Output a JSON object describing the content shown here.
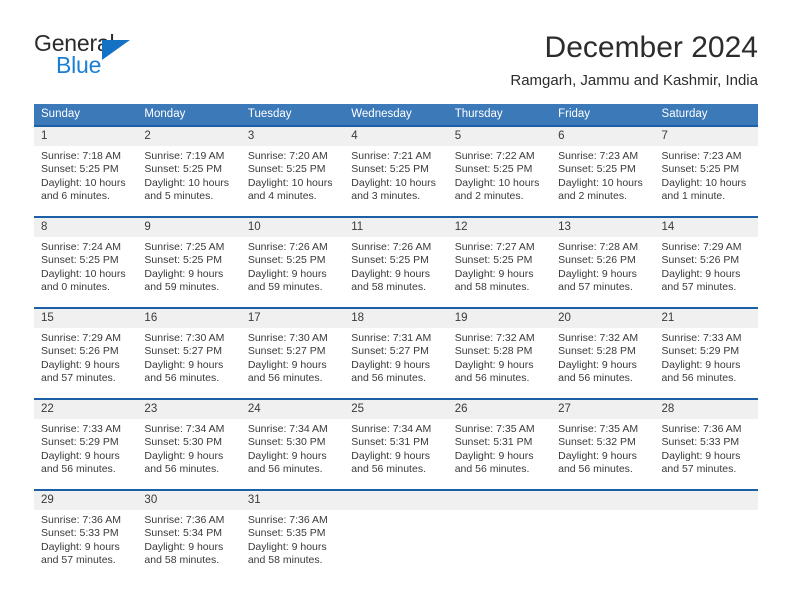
{
  "brand": {
    "name_top": "General",
    "name_bottom": "Blue",
    "triangle_color": "#1472c4",
    "blue_color": "#1a7fd4"
  },
  "header": {
    "title": "December 2024",
    "subtitle": "Ramgarh, Jammu and Kashmir, India"
  },
  "theme": {
    "header_bg": "#3b79b8",
    "header_text": "#ffffff",
    "week_border": "#1d5fa6",
    "daynum_bg": "#f0f0f0",
    "body_text": "#3a3a3a"
  },
  "weekdays": [
    "Sunday",
    "Monday",
    "Tuesday",
    "Wednesday",
    "Thursday",
    "Friday",
    "Saturday"
  ],
  "labels": {
    "sunrise_prefix": "Sunrise: ",
    "sunset_prefix": "Sunset: ",
    "daylight_prefix": "Daylight: "
  },
  "weeks": [
    [
      {
        "day": "1",
        "sunrise": "Sunrise: 7:18 AM",
        "sunset": "Sunset: 5:25 PM",
        "daylight": "Daylight: 10 hours and 6 minutes."
      },
      {
        "day": "2",
        "sunrise": "Sunrise: 7:19 AM",
        "sunset": "Sunset: 5:25 PM",
        "daylight": "Daylight: 10 hours and 5 minutes."
      },
      {
        "day": "3",
        "sunrise": "Sunrise: 7:20 AM",
        "sunset": "Sunset: 5:25 PM",
        "daylight": "Daylight: 10 hours and 4 minutes."
      },
      {
        "day": "4",
        "sunrise": "Sunrise: 7:21 AM",
        "sunset": "Sunset: 5:25 PM",
        "daylight": "Daylight: 10 hours and 3 minutes."
      },
      {
        "day": "5",
        "sunrise": "Sunrise: 7:22 AM",
        "sunset": "Sunset: 5:25 PM",
        "daylight": "Daylight: 10 hours and 2 minutes."
      },
      {
        "day": "6",
        "sunrise": "Sunrise: 7:23 AM",
        "sunset": "Sunset: 5:25 PM",
        "daylight": "Daylight: 10 hours and 2 minutes."
      },
      {
        "day": "7",
        "sunrise": "Sunrise: 7:23 AM",
        "sunset": "Sunset: 5:25 PM",
        "daylight": "Daylight: 10 hours and 1 minute."
      }
    ],
    [
      {
        "day": "8",
        "sunrise": "Sunrise: 7:24 AM",
        "sunset": "Sunset: 5:25 PM",
        "daylight": "Daylight: 10 hours and 0 minutes."
      },
      {
        "day": "9",
        "sunrise": "Sunrise: 7:25 AM",
        "sunset": "Sunset: 5:25 PM",
        "daylight": "Daylight: 9 hours and 59 minutes."
      },
      {
        "day": "10",
        "sunrise": "Sunrise: 7:26 AM",
        "sunset": "Sunset: 5:25 PM",
        "daylight": "Daylight: 9 hours and 59 minutes."
      },
      {
        "day": "11",
        "sunrise": "Sunrise: 7:26 AM",
        "sunset": "Sunset: 5:25 PM",
        "daylight": "Daylight: 9 hours and 58 minutes."
      },
      {
        "day": "12",
        "sunrise": "Sunrise: 7:27 AM",
        "sunset": "Sunset: 5:25 PM",
        "daylight": "Daylight: 9 hours and 58 minutes."
      },
      {
        "day": "13",
        "sunrise": "Sunrise: 7:28 AM",
        "sunset": "Sunset: 5:26 PM",
        "daylight": "Daylight: 9 hours and 57 minutes."
      },
      {
        "day": "14",
        "sunrise": "Sunrise: 7:29 AM",
        "sunset": "Sunset: 5:26 PM",
        "daylight": "Daylight: 9 hours and 57 minutes."
      }
    ],
    [
      {
        "day": "15",
        "sunrise": "Sunrise: 7:29 AM",
        "sunset": "Sunset: 5:26 PM",
        "daylight": "Daylight: 9 hours and 57 minutes."
      },
      {
        "day": "16",
        "sunrise": "Sunrise: 7:30 AM",
        "sunset": "Sunset: 5:27 PM",
        "daylight": "Daylight: 9 hours and 56 minutes."
      },
      {
        "day": "17",
        "sunrise": "Sunrise: 7:30 AM",
        "sunset": "Sunset: 5:27 PM",
        "daylight": "Daylight: 9 hours and 56 minutes."
      },
      {
        "day": "18",
        "sunrise": "Sunrise: 7:31 AM",
        "sunset": "Sunset: 5:27 PM",
        "daylight": "Daylight: 9 hours and 56 minutes."
      },
      {
        "day": "19",
        "sunrise": "Sunrise: 7:32 AM",
        "sunset": "Sunset: 5:28 PM",
        "daylight": "Daylight: 9 hours and 56 minutes."
      },
      {
        "day": "20",
        "sunrise": "Sunrise: 7:32 AM",
        "sunset": "Sunset: 5:28 PM",
        "daylight": "Daylight: 9 hours and 56 minutes."
      },
      {
        "day": "21",
        "sunrise": "Sunrise: 7:33 AM",
        "sunset": "Sunset: 5:29 PM",
        "daylight": "Daylight: 9 hours and 56 minutes."
      }
    ],
    [
      {
        "day": "22",
        "sunrise": "Sunrise: 7:33 AM",
        "sunset": "Sunset: 5:29 PM",
        "daylight": "Daylight: 9 hours and 56 minutes."
      },
      {
        "day": "23",
        "sunrise": "Sunrise: 7:34 AM",
        "sunset": "Sunset: 5:30 PM",
        "daylight": "Daylight: 9 hours and 56 minutes."
      },
      {
        "day": "24",
        "sunrise": "Sunrise: 7:34 AM",
        "sunset": "Sunset: 5:30 PM",
        "daylight": "Daylight: 9 hours and 56 minutes."
      },
      {
        "day": "25",
        "sunrise": "Sunrise: 7:34 AM",
        "sunset": "Sunset: 5:31 PM",
        "daylight": "Daylight: 9 hours and 56 minutes."
      },
      {
        "day": "26",
        "sunrise": "Sunrise: 7:35 AM",
        "sunset": "Sunset: 5:31 PM",
        "daylight": "Daylight: 9 hours and 56 minutes."
      },
      {
        "day": "27",
        "sunrise": "Sunrise: 7:35 AM",
        "sunset": "Sunset: 5:32 PM",
        "daylight": "Daylight: 9 hours and 56 minutes."
      },
      {
        "day": "28",
        "sunrise": "Sunrise: 7:36 AM",
        "sunset": "Sunset: 5:33 PM",
        "daylight": "Daylight: 9 hours and 57 minutes."
      }
    ],
    [
      {
        "day": "29",
        "sunrise": "Sunrise: 7:36 AM",
        "sunset": "Sunset: 5:33 PM",
        "daylight": "Daylight: 9 hours and 57 minutes."
      },
      {
        "day": "30",
        "sunrise": "Sunrise: 7:36 AM",
        "sunset": "Sunset: 5:34 PM",
        "daylight": "Daylight: 9 hours and 58 minutes."
      },
      {
        "day": "31",
        "sunrise": "Sunrise: 7:36 AM",
        "sunset": "Sunset: 5:35 PM",
        "daylight": "Daylight: 9 hours and 58 minutes."
      },
      {
        "day": "",
        "sunrise": "",
        "sunset": "",
        "daylight": ""
      },
      {
        "day": "",
        "sunrise": "",
        "sunset": "",
        "daylight": ""
      },
      {
        "day": "",
        "sunrise": "",
        "sunset": "",
        "daylight": ""
      },
      {
        "day": "",
        "sunrise": "",
        "sunset": "",
        "daylight": ""
      }
    ]
  ]
}
